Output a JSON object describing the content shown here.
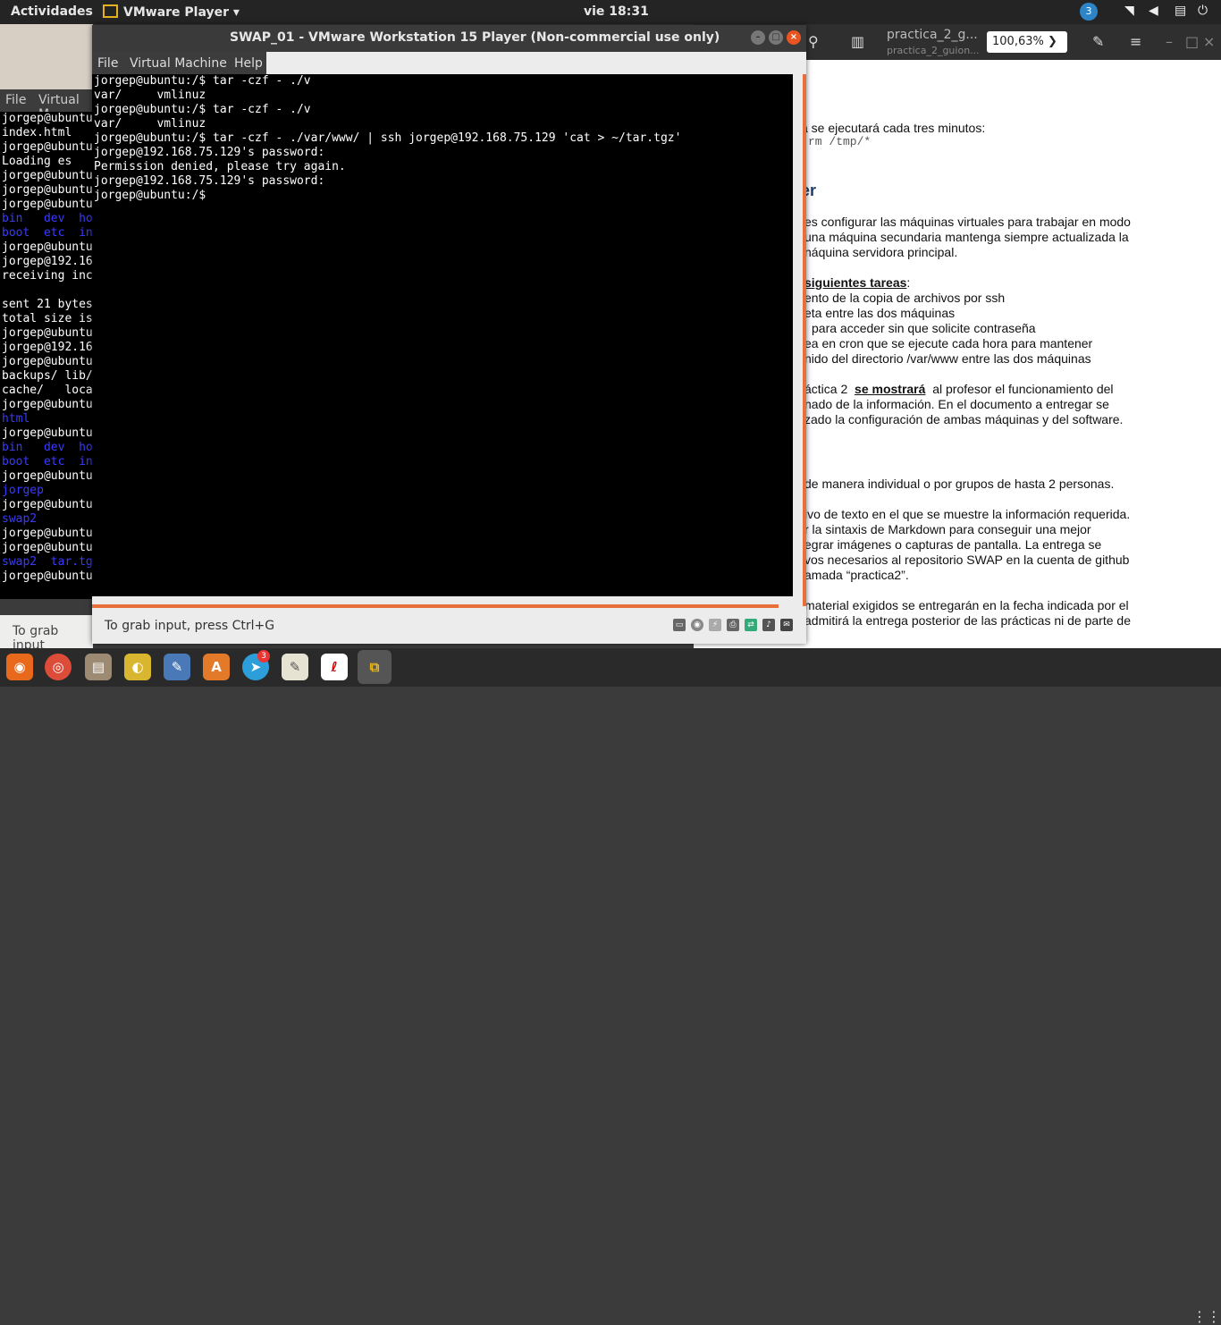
{
  "topbar": {
    "activities": "Actividades",
    "app_name": "VMware Player ▾",
    "clock": "vie 18:31",
    "notification_count": "3",
    "indicators": [
      "wifi-icon",
      "volume-icon",
      "clipboard-icon",
      "power-icon"
    ]
  },
  "doc_viewer": {
    "title": "practica_2_g...",
    "subtitle": "practica_2_guion...",
    "zoom": "100,63% ❯",
    "lines": [
      "a se ejecutará cada tres minutos:",
      "rm /tmp/*",
      "er",
      "es configurar las máquinas virtuales para trabajar en modo",
      "una máquina secundaria mantenga siempre actualizada la",
      "náquina servidora principal.",
      "siguientes tareas",
      ":",
      "ento de la copia de archivos por ssh",
      "eta entre las dos máquinas",
      "para acceder sin que solicite contraseña",
      "ea en cron que se ejecute cada hora para mantener",
      "nido del directorio /var/www entre las dos máquinas",
      "áctica 2",
      "se mostrará",
      "al profesor el funcionamiento del",
      "nado de la información. En el documento a entregar se",
      "zado la configuración de ambas máquinas y del software.",
      "de manera individual o por grupos de hasta 2 personas.",
      "ivo de texto en el que se muestre la información requerida.",
      "r la sintaxis de Markdown para conseguir una mejor",
      "egrar imágenes o capturas de pantalla. La entrega se",
      "vos necesarios al repositorio SWAP en la cuenta de github",
      "amada “practica2”.",
      "material exigidos se entregarán en la fecha indicada por el",
      "admitirá la entrega posterior de las prácticas ni de parte de"
    ]
  },
  "bg_terminal": {
    "menu": [
      "File",
      "Virtual M"
    ],
    "lines": [
      "jorgep@ubuntu",
      "index.html",
      "jorgep@ubuntu",
      "Loading es",
      "jorgep@ubuntu",
      "jorgep@ubuntu",
      "jorgep@ubuntu",
      "bin   dev  ho",
      "boot  etc  in",
      "jorgep@ubuntu",
      "jorgep@192.16",
      "receiving inc",
      "",
      "sent 21 bytes",
      "total size is",
      "jorgep@ubuntu",
      "jorgep@192.16",
      "jorgep@ubuntu",
      "backups/ lib/",
      "cache/   loca",
      "jorgep@ubuntu",
      "html",
      "jorgep@ubuntu",
      "bin   dev  ho",
      "boot  etc  in",
      "jorgep@ubuntu",
      "jorgep",
      "jorgep@ubuntu",
      "swap2",
      "jorgep@ubuntu",
      "jorgep@ubuntu",
      "swap2  tar.tg",
      "jorgep@ubuntu"
    ],
    "status": "To grab input"
  },
  "main_window": {
    "title": "SWAP_01 - VMware Workstation 15 Player (Non-commercial use only)",
    "menu": [
      "File",
      "Virtual Machine",
      "Help"
    ],
    "terminal_lines": [
      "jorgep@ubuntu:/$ tar -czf - ./v",
      "var/     vmlinuz",
      "jorgep@ubuntu:/$ tar -czf - ./v",
      "var/     vmlinuz",
      "jorgep@ubuntu:/$ tar -czf - ./var/www/ | ssh jorgep@192.168.75.129 'cat > ~/tar.tgz'",
      "jorgep@192.168.75.129's password:",
      "Permission denied, please try again.",
      "jorgep@192.168.75.129's password:",
      "jorgep@ubuntu:/$ "
    ],
    "status_text": "To grab input, press Ctrl+G",
    "status_icons": [
      "hdd-icon",
      "cd-icon",
      "usb-icon",
      "printer-icon",
      "network-icon",
      "sound-icon",
      "message-icon"
    ]
  },
  "dock": {
    "apps": [
      "firefox-icon",
      "chrome-icon",
      "files-icon",
      "camera-icon",
      "text-editor-icon",
      "software-center-icon",
      "telegram-icon",
      "notes-icon",
      "acrobat-icon",
      "vmware-icon"
    ],
    "telegram_badge": "3"
  },
  "colors": {
    "accent": "#e86f3a",
    "terminal_bg": "#000000",
    "topbar": "#242424"
  }
}
